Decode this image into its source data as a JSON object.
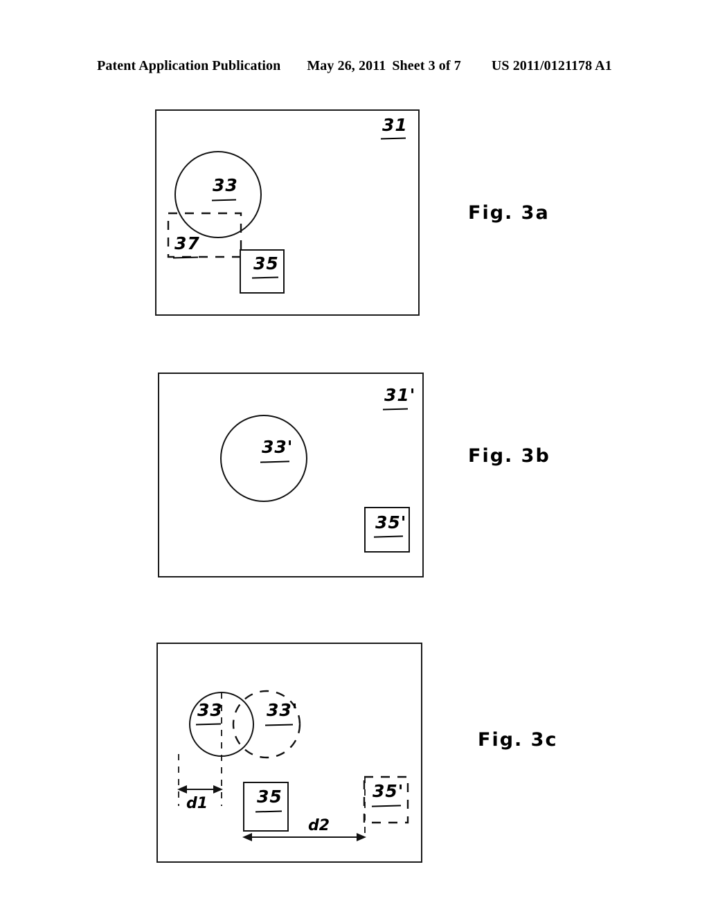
{
  "header": {
    "publication": "Patent Application Publication",
    "date": "May 26, 2011",
    "sheet": "Sheet 3 of 7",
    "patent_number": "US 2011/0121178 A1"
  },
  "figures": [
    {
      "caption": "Fig. 3a",
      "frame_label": "31",
      "labels": {
        "circle": "33",
        "dashed_region": "37",
        "square": "35"
      }
    },
    {
      "caption": "Fig. 3b",
      "frame_label": "31'",
      "labels": {
        "circle": "33'",
        "square": "35'"
      }
    },
    {
      "caption": "Fig. 3c",
      "frame_label": "",
      "labels": {
        "circle_solid": "33",
        "circle_dashed": "33'",
        "square_solid": "35",
        "square_dashed": "35'",
        "dimension_1": "d1",
        "dimension_2": "d2"
      }
    }
  ],
  "colors": {
    "ink": "#111111",
    "page": "#ffffff"
  }
}
